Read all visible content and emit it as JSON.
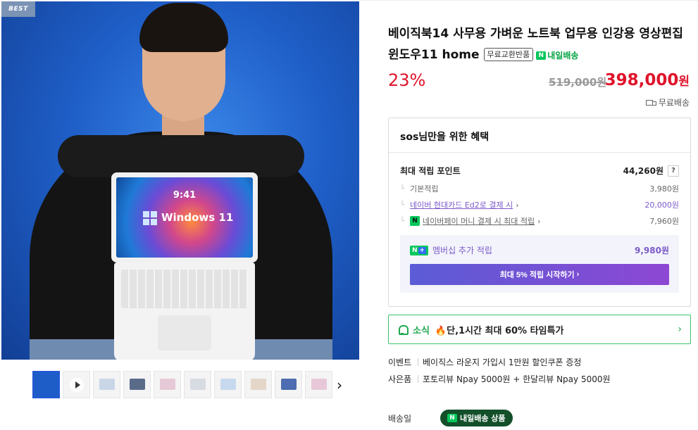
{
  "gallery": {
    "badge": "BEST",
    "laptop_time": "9:41",
    "laptop_brand": "Windows 11",
    "thumbnails": [
      {
        "kind": "photo",
        "color": "#1e5cc8",
        "active": true
      },
      {
        "kind": "video"
      },
      {
        "kind": "image",
        "color": "#c9d6e8"
      },
      {
        "kind": "image",
        "color": "#5a6b8a"
      },
      {
        "kind": "image",
        "color": "#e6c9d6"
      },
      {
        "kind": "image",
        "color": "#d7dbe2"
      },
      {
        "kind": "image",
        "color": "#c7d9ee"
      },
      {
        "kind": "image",
        "color": "#e4d6c8"
      },
      {
        "kind": "image",
        "color": "#4d6cb1"
      },
      {
        "kind": "image",
        "color": "#e8c8d8"
      }
    ],
    "next_icon": "›"
  },
  "product": {
    "title": "베이직북14 사무용 가벼운 노트북 업무용 인강용 영상편집 윈도우11 home",
    "tag_exchange": "무료교환반품",
    "tag_delivery": "내일배송",
    "discount": "23%",
    "original_price": "519,000원",
    "price": "398,000",
    "price_unit": "원",
    "shipping": "무료배송"
  },
  "benefit": {
    "header": "sos님만을 위한 혜택",
    "max_points_label": "최대 적립 포인트",
    "max_points_value": "44,260원",
    "help": "?",
    "rows": [
      {
        "label": "기본적립",
        "value": "3,980원"
      },
      {
        "label": "네이버 현대카드 Ed2로 결제 시",
        "value": "20,000원"
      },
      {
        "label": "네이버페이 머니 결제 시 최대 적립",
        "value": "7,960원"
      }
    ],
    "member_label": "멤버십 추가 적립",
    "member_value": "9,980원",
    "member_button": "최대 5% 적립 시작하기",
    "chevron": "›"
  },
  "news": {
    "label": "소식",
    "text": "단,1시간 최대 60% 타임특가",
    "fire": "🔥",
    "arrow": "›"
  },
  "extras": {
    "event_key": "이벤트",
    "event_val": "베이직스 라운지 가입시 1만원 할인쿠폰 증정",
    "gift_key": "사은품",
    "gift_val": "포토리뷰 Npay 5000원 + 한달리뷰 Npay 5000원"
  },
  "delivery": {
    "key": "배송일",
    "pill": "내일배송 상품"
  },
  "colors": {
    "accent_red": "#e0142b",
    "naver_green": "#03c75a",
    "member_purple": "#7b5ac8"
  }
}
